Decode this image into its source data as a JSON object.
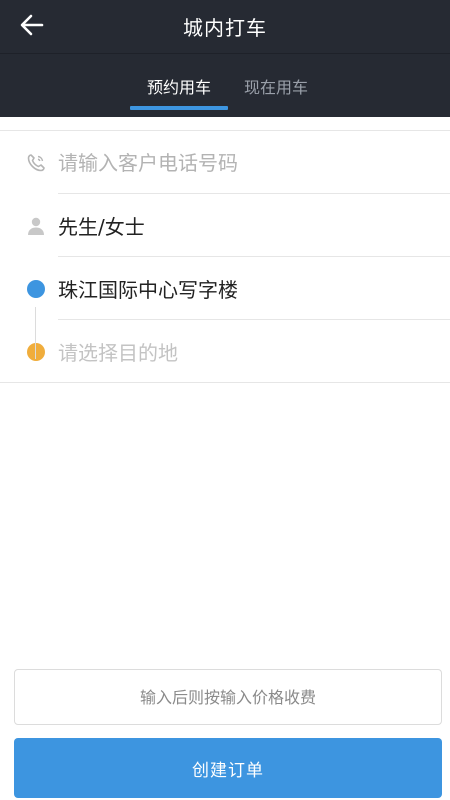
{
  "header": {
    "back_icon": "arrow-left-icon",
    "title": "城内打车"
  },
  "tabs": [
    {
      "label": "预约用车",
      "active": true
    },
    {
      "label": "现在用车",
      "active": false
    }
  ],
  "form": {
    "phone": {
      "icon": "phone-icon",
      "value": "",
      "placeholder": "请输入客户电话号码"
    },
    "name": {
      "icon": "user-icon",
      "value": "先生/女士"
    },
    "origin": {
      "icon": "origin-dot-icon",
      "value": "珠江国际中心写字楼"
    },
    "destination": {
      "icon": "destination-dot-icon",
      "placeholder": "请选择目的地"
    }
  },
  "price": {
    "value": "",
    "placeholder": "输入后则按输入价格收费"
  },
  "submit": {
    "label": "创建订单"
  },
  "colors": {
    "header_bg": "#262a33",
    "accent": "#3d95e0",
    "origin_dot": "#3d95e0",
    "destination_dot": "#f0ad3c"
  }
}
